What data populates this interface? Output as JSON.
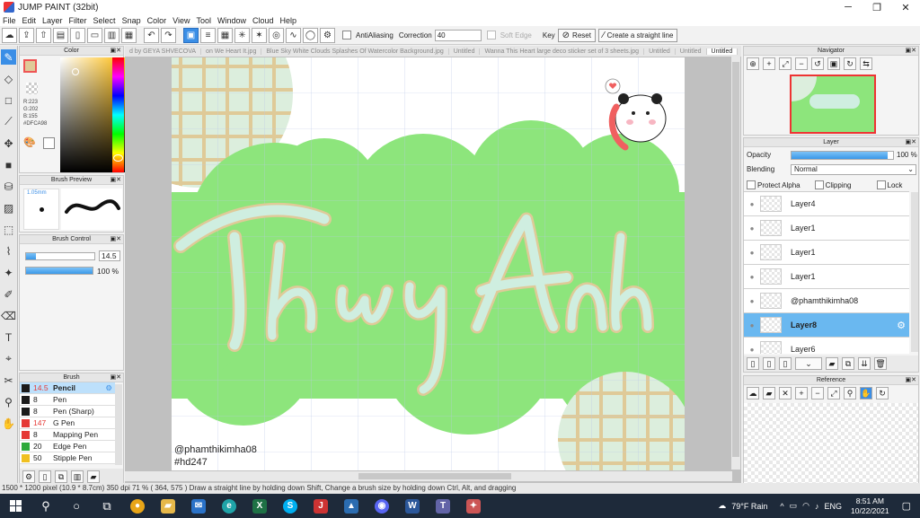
{
  "window": {
    "title": "JUMP PAINT (32bit)",
    "controls": [
      "─",
      "❐",
      "✕"
    ]
  },
  "menu": [
    "File",
    "Edit",
    "Layer",
    "Filter",
    "Select",
    "Snap",
    "Color",
    "View",
    "Tool",
    "Window",
    "Cloud",
    "Help"
  ],
  "toolbar": {
    "antialiasing_label": "AntiAliasing",
    "correction_label": "Correction",
    "correction_value": "40",
    "soft_edge_label": "Soft Edge",
    "key_label": "Key",
    "reset_label": "Reset",
    "straight_line_label": "Create a straight line"
  },
  "tabs": [
    "d by GEYA SHVECOVA",
    "on We Heart It.jpg",
    "Blue Sky White Clouds Splashes Of Watercolor Background.jpg",
    "Untitled",
    "Wanna This Heart large deco sticker set of 3 sheets.jpg",
    "Untitled",
    "Untitled",
    "Untitled"
  ],
  "color_panel": {
    "title": "Color",
    "r": "R:223",
    "g": "G:202",
    "b": "B:155",
    "hex": "#DFCA98",
    "current": "#dfca98"
  },
  "brush_preview": {
    "title": "Brush Preview",
    "size": "1.05mm"
  },
  "brush_control": {
    "title": "Brush Control",
    "size_value": "14.5",
    "opacity_value": "100 %",
    "size_fraction": 0.15,
    "opacity_fraction": 1.0
  },
  "brush_list": {
    "title": "Brush",
    "items": [
      {
        "size": "14.5",
        "name": "Pencil",
        "color": "#1a1a1a"
      },
      {
        "size": "8",
        "name": "Pen",
        "color": "#1a1a1a"
      },
      {
        "size": "8",
        "name": "Pen (Sharp)",
        "color": "#1a1a1a"
      },
      {
        "size": "147",
        "name": "G Pen",
        "color": "#e53935"
      },
      {
        "size": "8",
        "name": "Mapping Pen",
        "color": "#e53935"
      },
      {
        "size": "20",
        "name": "Edge Pen",
        "color": "#2eaa3c"
      },
      {
        "size": "50",
        "name": "Stipple Pen",
        "color": "#f0c020"
      }
    ]
  },
  "canvas": {
    "watermark_user": "@phamthikimha08",
    "watermark_tag": "#hd247",
    "lettering": "Thùy Anh",
    "background_green": "#8de57c",
    "accent_tan": "#dfca98"
  },
  "navigator": {
    "title": "Navigator"
  },
  "layer_panel": {
    "title": "Layer",
    "opacity_label": "Opacity",
    "opacity_value": "100 %",
    "opacity_fraction": 0.95,
    "blending_label": "Blending",
    "blending_value": "Normal",
    "protect_alpha": "Protect Alpha",
    "clipping": "Clipping",
    "lock": "Lock",
    "layers": [
      "Layer4",
      "Layer1",
      "Layer1",
      "Layer1",
      "@phamthikimha08",
      "Layer8",
      "Layer6"
    ],
    "selected_index": 5
  },
  "reference": {
    "title": "Reference"
  },
  "status": "1500 * 1200 pixel  (10.9 * 8.7cm)  350 dpi  71 %  ( 364, 575 )  Draw a straight line by holding down Shift, Change a brush size by holding down Ctrl, Alt, and dragging",
  "taskbar": {
    "weather": "79°F  Rain",
    "lang": "ENG",
    "time": "8:51 AM",
    "date": "10/22/2021"
  }
}
